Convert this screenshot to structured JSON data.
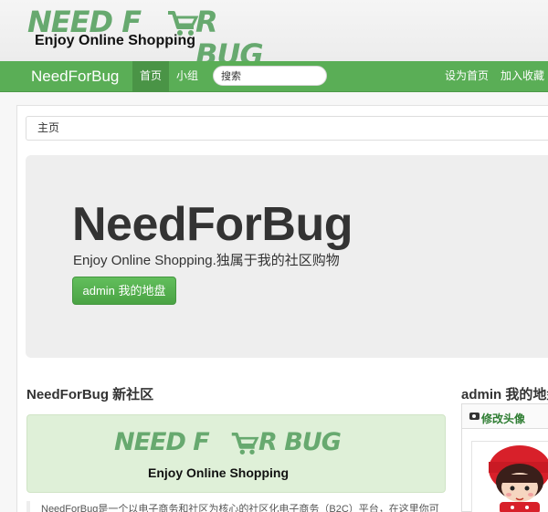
{
  "header": {
    "logo_text": "NEED FOR BUG",
    "logo_parts": [
      "NEED F",
      "R BUG"
    ],
    "tagline": "Enjoy Online Shopping"
  },
  "navbar": {
    "brand": "NeedForBug",
    "items": [
      {
        "label": "首页",
        "active": true
      },
      {
        "label": "小组",
        "active": false
      }
    ],
    "search_value": "搜索",
    "right_links": [
      "设为首页",
      "加入收藏"
    ]
  },
  "breadcrumb": "主页",
  "jumbotron": {
    "title": "NeedForBug",
    "subtitle": "Enjoy Online Shopping.独属于我的社区购物",
    "button": "admin 我的地盘"
  },
  "community": {
    "title": "NeedForBug 新社区",
    "logo_text": "NEED FOR BUG",
    "logo_parts": [
      "NEED F",
      "R BUG"
    ],
    "tagline": "Enjoy Online Shopping",
    "description": "NeedForBug是一个以电子商务和社区为核心的社区化电子商务（B2C）平台，在这里你可"
  },
  "sidebar": {
    "title": "admin 我的地盘",
    "edit_avatar": "修改头像"
  },
  "colors": {
    "brand_green": "#5aae56",
    "logo_green": "#67a96f",
    "panel_green": "#dff0d8"
  }
}
